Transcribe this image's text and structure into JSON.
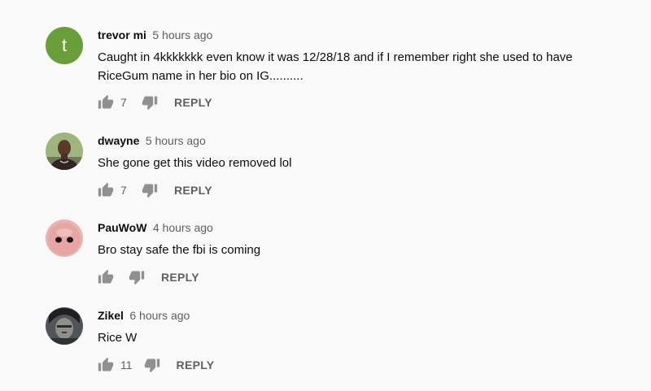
{
  "comments": [
    {
      "author": "trevor mi",
      "time": "5 hours ago",
      "avatar_letter": "t",
      "text": "Caught in 4kkkkkkk even know it was 12/28/18 and if I remember right she used to have RiceGum name in her bio on IG..........",
      "likes": "7",
      "reply_label": "REPLY"
    },
    {
      "author": "dwayne",
      "time": "5 hours ago",
      "text": "She gone get this video removed lol",
      "likes": "7",
      "reply_label": "REPLY"
    },
    {
      "author": "PauWoW",
      "time": "4 hours ago",
      "text": "Bro stay safe the fbi is coming",
      "likes": "",
      "reply_label": "REPLY"
    },
    {
      "author": "Zikel",
      "time": "6 hours ago",
      "text": "Rice W",
      "likes": "11",
      "reply_label": "REPLY"
    }
  ],
  "icons": {
    "like": "thumb-up-icon",
    "dislike": "thumb-down-icon"
  },
  "colors": {
    "background": "#f9f9f9",
    "avatar_t": "#689f38",
    "icon": "#909090",
    "meta_text": "#606060"
  }
}
